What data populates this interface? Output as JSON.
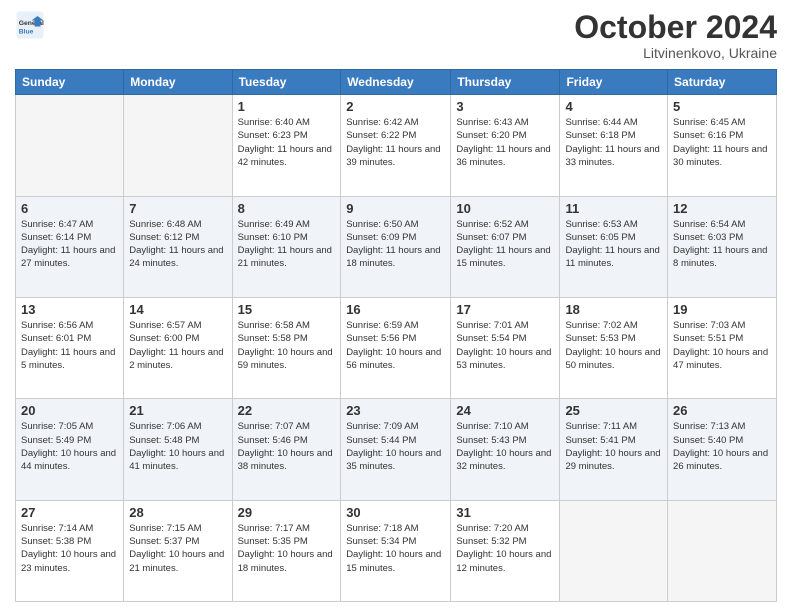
{
  "header": {
    "logo_general": "General",
    "logo_blue": "Blue",
    "month": "October 2024",
    "location": "Litvinenkovo, Ukraine"
  },
  "days_of_week": [
    "Sunday",
    "Monday",
    "Tuesday",
    "Wednesday",
    "Thursday",
    "Friday",
    "Saturday"
  ],
  "weeks": [
    [
      {
        "day": "",
        "sunrise": "",
        "sunset": "",
        "daylight": ""
      },
      {
        "day": "",
        "sunrise": "",
        "sunset": "",
        "daylight": ""
      },
      {
        "day": "1",
        "sunrise": "Sunrise: 6:40 AM",
        "sunset": "Sunset: 6:23 PM",
        "daylight": "Daylight: 11 hours and 42 minutes."
      },
      {
        "day": "2",
        "sunrise": "Sunrise: 6:42 AM",
        "sunset": "Sunset: 6:22 PM",
        "daylight": "Daylight: 11 hours and 39 minutes."
      },
      {
        "day": "3",
        "sunrise": "Sunrise: 6:43 AM",
        "sunset": "Sunset: 6:20 PM",
        "daylight": "Daylight: 11 hours and 36 minutes."
      },
      {
        "day": "4",
        "sunrise": "Sunrise: 6:44 AM",
        "sunset": "Sunset: 6:18 PM",
        "daylight": "Daylight: 11 hours and 33 minutes."
      },
      {
        "day": "5",
        "sunrise": "Sunrise: 6:45 AM",
        "sunset": "Sunset: 6:16 PM",
        "daylight": "Daylight: 11 hours and 30 minutes."
      }
    ],
    [
      {
        "day": "6",
        "sunrise": "Sunrise: 6:47 AM",
        "sunset": "Sunset: 6:14 PM",
        "daylight": "Daylight: 11 hours and 27 minutes."
      },
      {
        "day": "7",
        "sunrise": "Sunrise: 6:48 AM",
        "sunset": "Sunset: 6:12 PM",
        "daylight": "Daylight: 11 hours and 24 minutes."
      },
      {
        "day": "8",
        "sunrise": "Sunrise: 6:49 AM",
        "sunset": "Sunset: 6:10 PM",
        "daylight": "Daylight: 11 hours and 21 minutes."
      },
      {
        "day": "9",
        "sunrise": "Sunrise: 6:50 AM",
        "sunset": "Sunset: 6:09 PM",
        "daylight": "Daylight: 11 hours and 18 minutes."
      },
      {
        "day": "10",
        "sunrise": "Sunrise: 6:52 AM",
        "sunset": "Sunset: 6:07 PM",
        "daylight": "Daylight: 11 hours and 15 minutes."
      },
      {
        "day": "11",
        "sunrise": "Sunrise: 6:53 AM",
        "sunset": "Sunset: 6:05 PM",
        "daylight": "Daylight: 11 hours and 11 minutes."
      },
      {
        "day": "12",
        "sunrise": "Sunrise: 6:54 AM",
        "sunset": "Sunset: 6:03 PM",
        "daylight": "Daylight: 11 hours and 8 minutes."
      }
    ],
    [
      {
        "day": "13",
        "sunrise": "Sunrise: 6:56 AM",
        "sunset": "Sunset: 6:01 PM",
        "daylight": "Daylight: 11 hours and 5 minutes."
      },
      {
        "day": "14",
        "sunrise": "Sunrise: 6:57 AM",
        "sunset": "Sunset: 6:00 PM",
        "daylight": "Daylight: 11 hours and 2 minutes."
      },
      {
        "day": "15",
        "sunrise": "Sunrise: 6:58 AM",
        "sunset": "Sunset: 5:58 PM",
        "daylight": "Daylight: 10 hours and 59 minutes."
      },
      {
        "day": "16",
        "sunrise": "Sunrise: 6:59 AM",
        "sunset": "Sunset: 5:56 PM",
        "daylight": "Daylight: 10 hours and 56 minutes."
      },
      {
        "day": "17",
        "sunrise": "Sunrise: 7:01 AM",
        "sunset": "Sunset: 5:54 PM",
        "daylight": "Daylight: 10 hours and 53 minutes."
      },
      {
        "day": "18",
        "sunrise": "Sunrise: 7:02 AM",
        "sunset": "Sunset: 5:53 PM",
        "daylight": "Daylight: 10 hours and 50 minutes."
      },
      {
        "day": "19",
        "sunrise": "Sunrise: 7:03 AM",
        "sunset": "Sunset: 5:51 PM",
        "daylight": "Daylight: 10 hours and 47 minutes."
      }
    ],
    [
      {
        "day": "20",
        "sunrise": "Sunrise: 7:05 AM",
        "sunset": "Sunset: 5:49 PM",
        "daylight": "Daylight: 10 hours and 44 minutes."
      },
      {
        "day": "21",
        "sunrise": "Sunrise: 7:06 AM",
        "sunset": "Sunset: 5:48 PM",
        "daylight": "Daylight: 10 hours and 41 minutes."
      },
      {
        "day": "22",
        "sunrise": "Sunrise: 7:07 AM",
        "sunset": "Sunset: 5:46 PM",
        "daylight": "Daylight: 10 hours and 38 minutes."
      },
      {
        "day": "23",
        "sunrise": "Sunrise: 7:09 AM",
        "sunset": "Sunset: 5:44 PM",
        "daylight": "Daylight: 10 hours and 35 minutes."
      },
      {
        "day": "24",
        "sunrise": "Sunrise: 7:10 AM",
        "sunset": "Sunset: 5:43 PM",
        "daylight": "Daylight: 10 hours and 32 minutes."
      },
      {
        "day": "25",
        "sunrise": "Sunrise: 7:11 AM",
        "sunset": "Sunset: 5:41 PM",
        "daylight": "Daylight: 10 hours and 29 minutes."
      },
      {
        "day": "26",
        "sunrise": "Sunrise: 7:13 AM",
        "sunset": "Sunset: 5:40 PM",
        "daylight": "Daylight: 10 hours and 26 minutes."
      }
    ],
    [
      {
        "day": "27",
        "sunrise": "Sunrise: 7:14 AM",
        "sunset": "Sunset: 5:38 PM",
        "daylight": "Daylight: 10 hours and 23 minutes."
      },
      {
        "day": "28",
        "sunrise": "Sunrise: 7:15 AM",
        "sunset": "Sunset: 5:37 PM",
        "daylight": "Daylight: 10 hours and 21 minutes."
      },
      {
        "day": "29",
        "sunrise": "Sunrise: 7:17 AM",
        "sunset": "Sunset: 5:35 PM",
        "daylight": "Daylight: 10 hours and 18 minutes."
      },
      {
        "day": "30",
        "sunrise": "Sunrise: 7:18 AM",
        "sunset": "Sunset: 5:34 PM",
        "daylight": "Daylight: 10 hours and 15 minutes."
      },
      {
        "day": "31",
        "sunrise": "Sunrise: 7:20 AM",
        "sunset": "Sunset: 5:32 PM",
        "daylight": "Daylight: 10 hours and 12 minutes."
      },
      {
        "day": "",
        "sunrise": "",
        "sunset": "",
        "daylight": ""
      },
      {
        "day": "",
        "sunrise": "",
        "sunset": "",
        "daylight": ""
      }
    ]
  ]
}
